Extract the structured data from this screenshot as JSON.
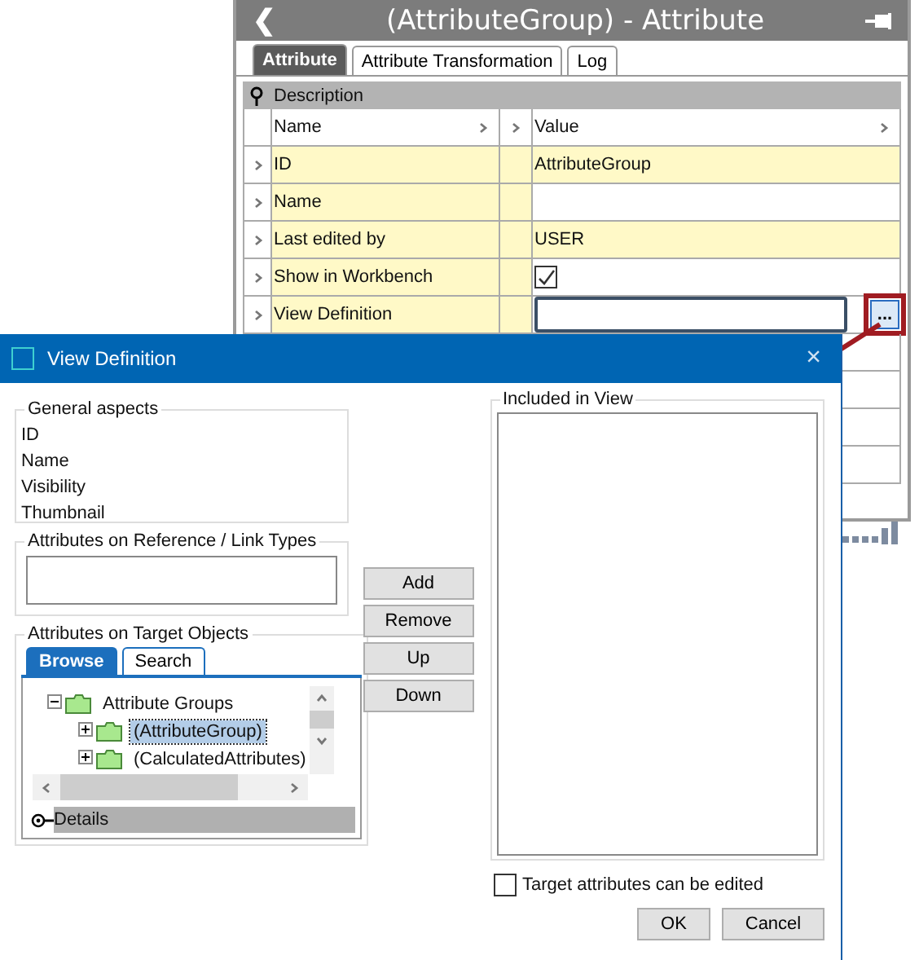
{
  "panel": {
    "title": "(AttributeGroup) - Attribute",
    "back": "❮",
    "tabs": [
      {
        "label": "Attribute",
        "selected": true
      },
      {
        "label": "Attribute Transformation",
        "selected": false
      },
      {
        "label": "Log",
        "selected": false
      }
    ],
    "section": "Description",
    "columns": [
      "Name",
      "Value"
    ],
    "rows": [
      {
        "name": "ID",
        "kind": "text",
        "value": "AttributeGroup",
        "highlighted": true
      },
      {
        "name": "Name",
        "kind": "text",
        "value": "",
        "highlighted": false
      },
      {
        "name": "Last edited by",
        "kind": "text",
        "value": "USER",
        "highlighted": true
      },
      {
        "name": "Show in Workbench",
        "kind": "checkbox",
        "checked": true,
        "highlighted": false
      },
      {
        "name": "View Definition",
        "kind": "field",
        "button": "...",
        "highlighted": false
      }
    ]
  },
  "dialog": {
    "title": "View Definition",
    "close": "×",
    "general": {
      "legend": "General aspects",
      "items": [
        "ID",
        "Name",
        "Visibility",
        "Thumbnail"
      ]
    },
    "reference": {
      "legend": "Attributes on Reference / Link Types"
    },
    "target": {
      "legend": "Attributes on Target Objects",
      "tabs": [
        {
          "label": "Browse",
          "selected": true
        },
        {
          "label": "Search",
          "selected": false
        }
      ],
      "tree": [
        {
          "label": "Attribute Groups",
          "expanded": true,
          "selected": false,
          "children": [
            {
              "label": "(AttributeGroup)",
              "expanded": false,
              "selected": true
            },
            {
              "label": "(CalculatedAttributes)",
              "expanded": false,
              "selected": false
            }
          ]
        }
      ],
      "details": "Details"
    },
    "actions": [
      "Add",
      "Remove",
      "Up",
      "Down"
    ],
    "included": {
      "legend": "Included in View"
    },
    "editable": {
      "label": "Target attributes can be edited",
      "checked": false
    },
    "buttons": [
      "OK",
      "Cancel"
    ]
  }
}
